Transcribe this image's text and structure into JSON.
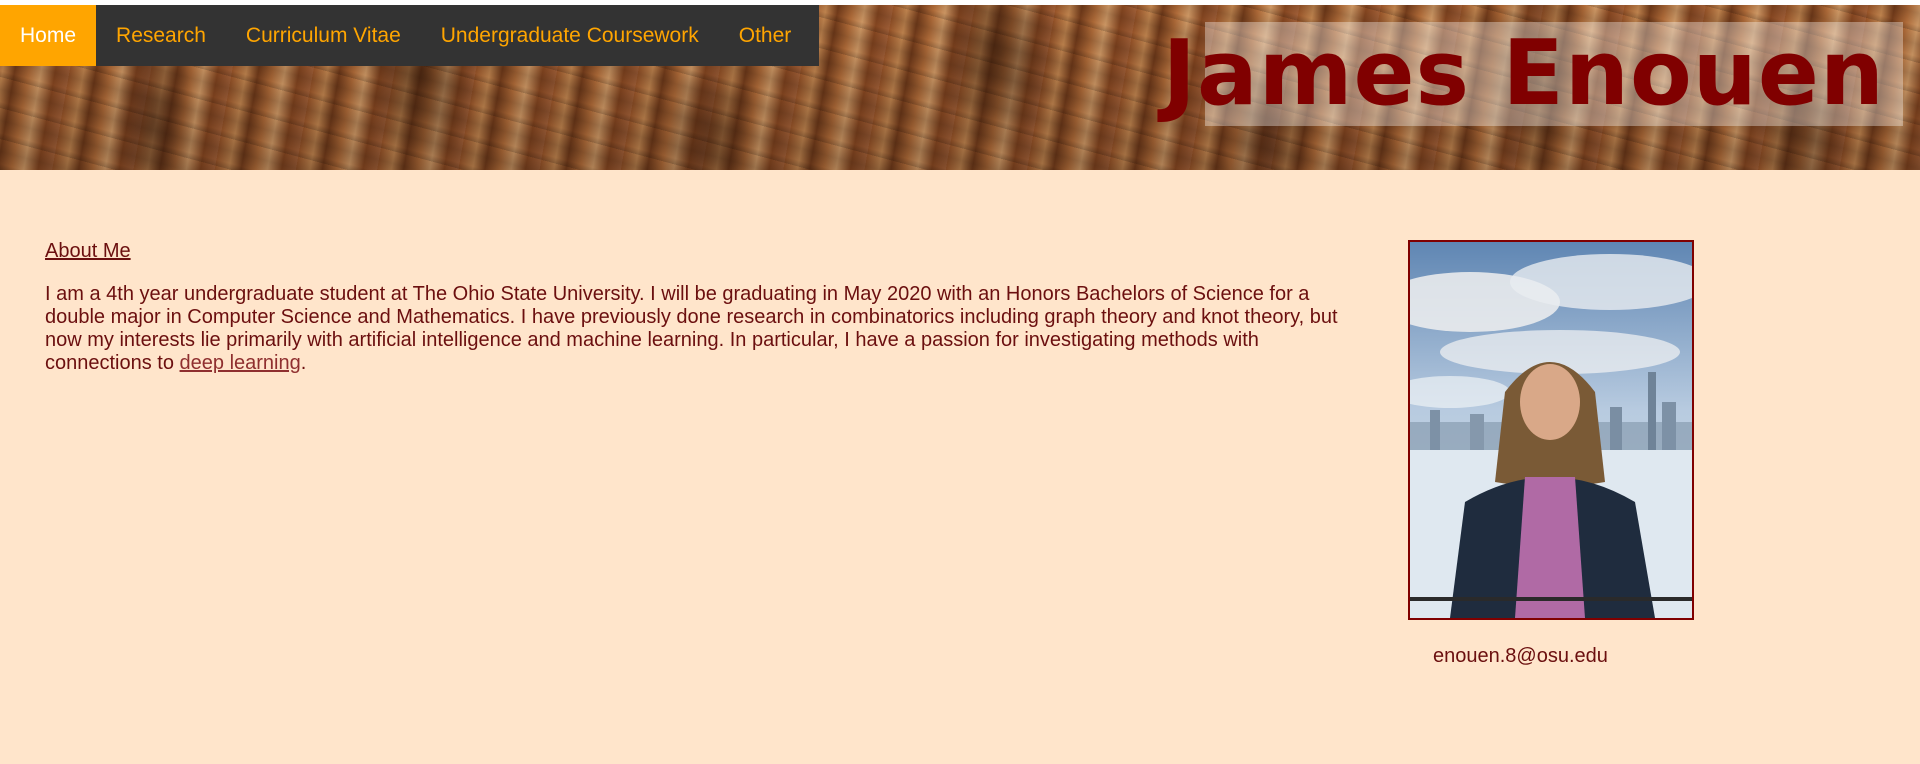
{
  "nav": {
    "items": [
      {
        "label": "Home",
        "active": true
      },
      {
        "label": "Research",
        "active": false
      },
      {
        "label": "Curriculum Vitae",
        "active": false
      },
      {
        "label": "Undergraduate Coursework",
        "active": false
      },
      {
        "label": "Other",
        "active": false
      }
    ]
  },
  "header": {
    "title": "James Enouen",
    "background": "bark texture"
  },
  "about": {
    "heading": "About Me",
    "text_before_link": "I am a 4th year undergraduate student at The Ohio State University. I will be graduating in May 2020 with an Honors Bachelors of Science for a double major in Computer Science and Mathematics. I have previously done research in combinatorics including graph theory and knot theory, but now my interests lie primarily with artificial intelligence and machine learning. In particular, I have a passion for investigating methods with connections to ",
    "link_text": "deep learning",
    "text_after_link": "."
  },
  "profile": {
    "photo": "portrait-photo",
    "email": "enouen.8@osu.edu"
  },
  "colors": {
    "page_background": "#ffe5cb",
    "nav_background": "#333333",
    "nav_text": "#ffa500",
    "nav_active": "#ffa500",
    "title_color": "#800000",
    "text_color": "#6b0f0f"
  }
}
